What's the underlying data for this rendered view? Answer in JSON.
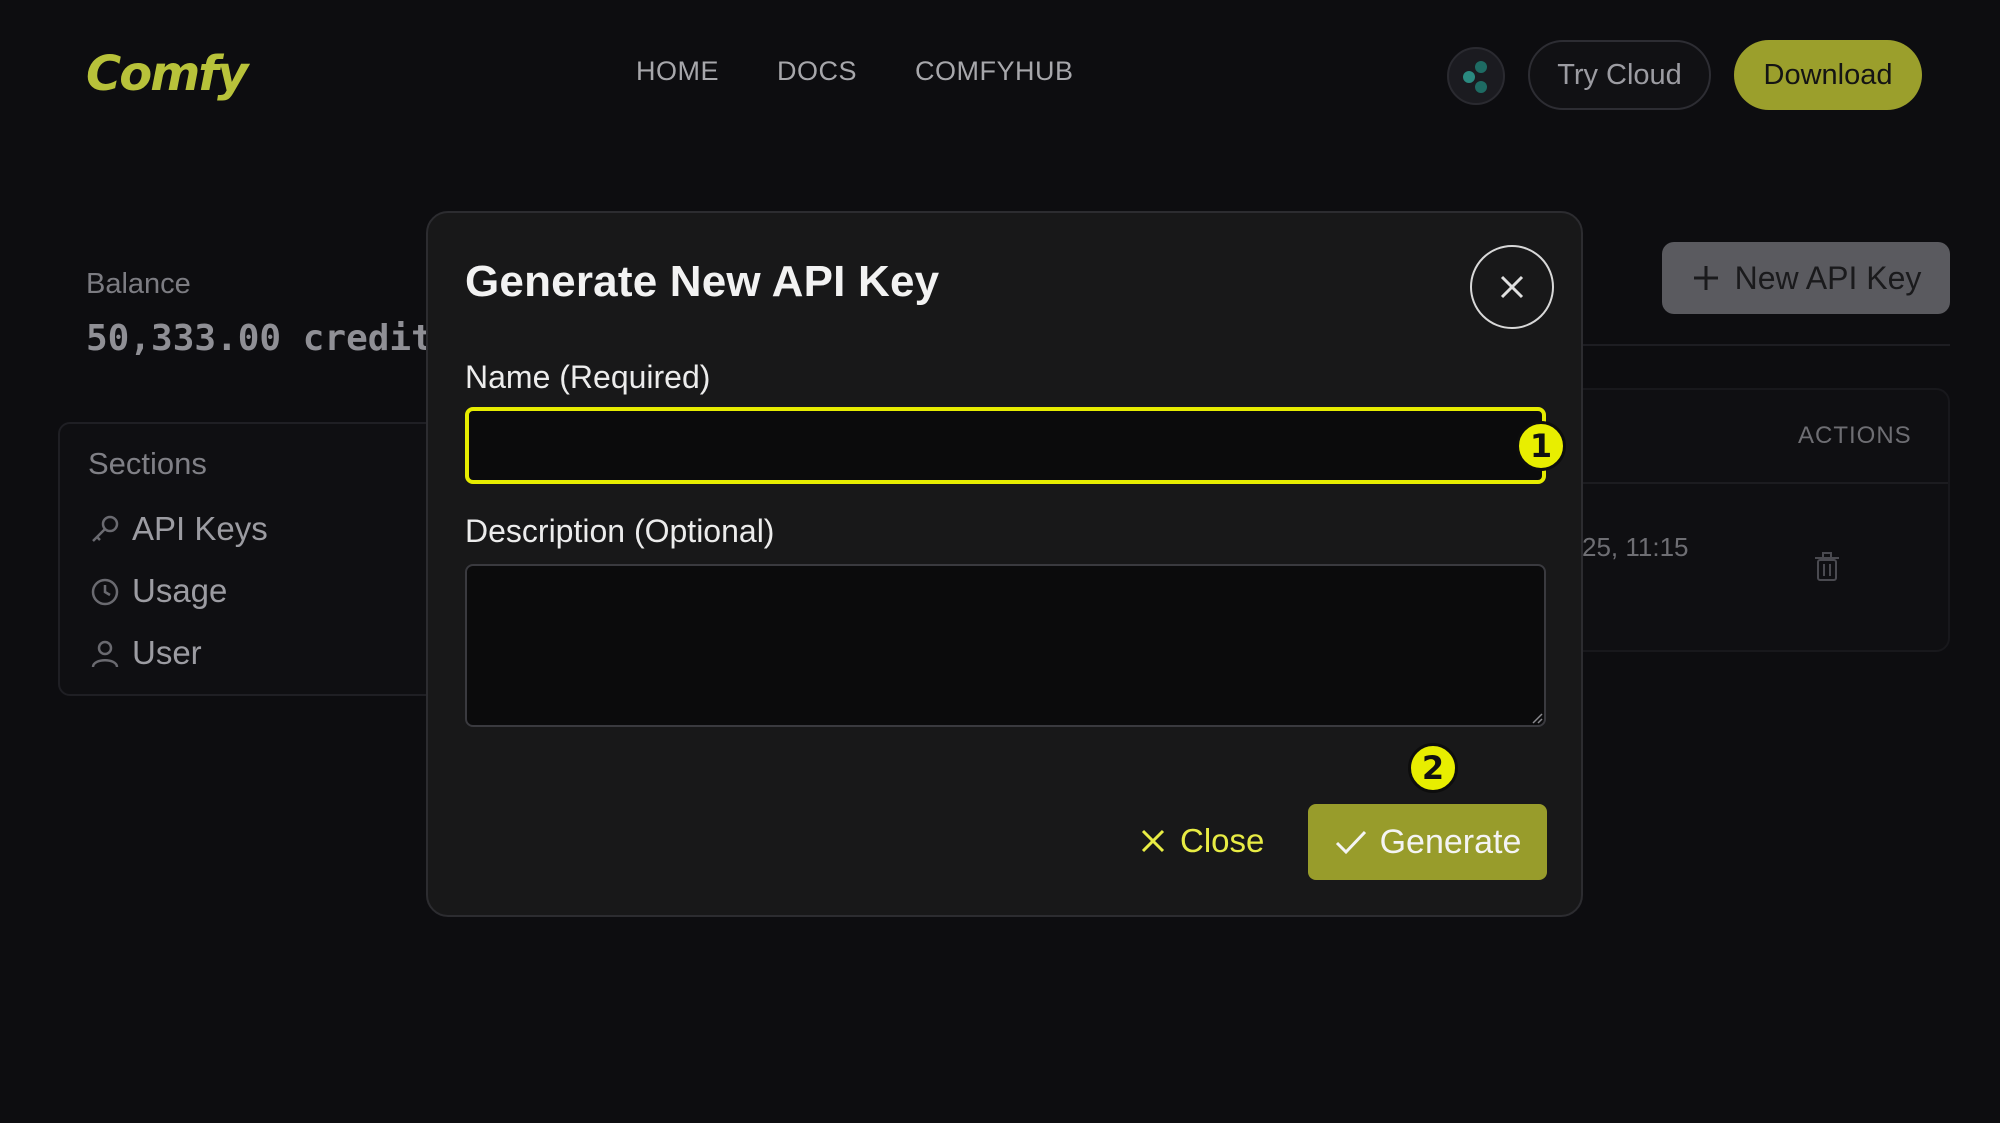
{
  "nav": {
    "logo": "Comfy",
    "links": [
      "HOME",
      "DOCS",
      "COMFYHUB"
    ],
    "try_cloud": "Try Cloud",
    "download": "Download"
  },
  "balance": {
    "label": "Balance",
    "value": "50,333.00 credit"
  },
  "sections": {
    "title": "Sections",
    "items": [
      {
        "label": "API Keys",
        "icon": "key-icon"
      },
      {
        "label": "Usage",
        "icon": "clock-icon"
      },
      {
        "label": "User",
        "icon": "user-icon"
      }
    ]
  },
  "api_keys": {
    "new_button": "New API Key",
    "actions_header": "ACTIONS",
    "row_date": "25, 11:15"
  },
  "modal": {
    "title": "Generate New API Key",
    "name_label": "Name (Required)",
    "name_value": "",
    "description_label": "Description (Optional)",
    "description_value": "",
    "close_label": "Close",
    "generate_label": "Generate"
  },
  "annotations": [
    "1",
    "2"
  ],
  "colors": {
    "accent": "#e8ee00",
    "brand_olive": "#989c2b",
    "background": "#0d0d10",
    "modal_bg": "#181819"
  }
}
